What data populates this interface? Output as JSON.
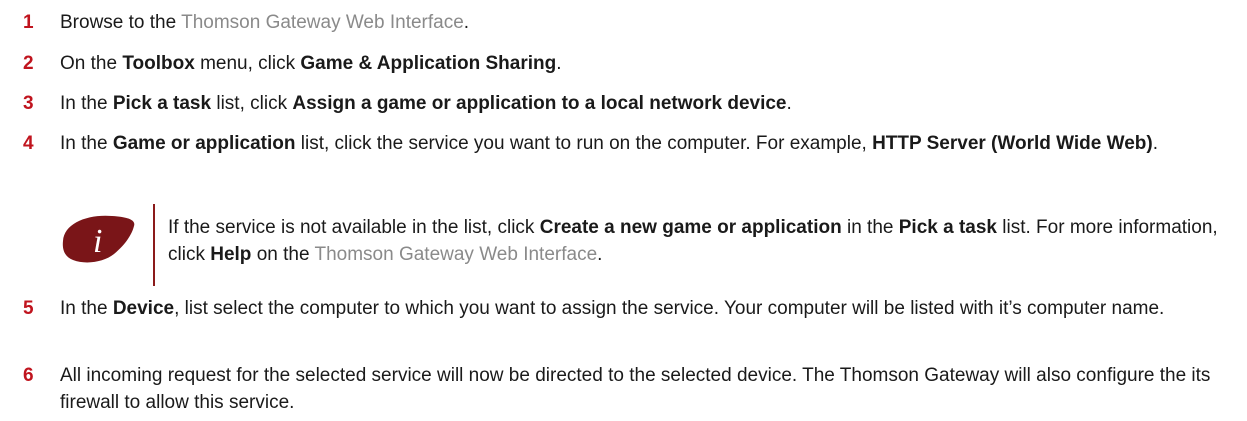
{
  "steps": [
    {
      "num": "1",
      "parts": [
        {
          "t": "Browse to the "
        },
        {
          "t": "Thomson Gateway Web Interface",
          "s": "link"
        },
        {
          "t": "."
        }
      ]
    },
    {
      "num": "2",
      "parts": [
        {
          "t": "On the "
        },
        {
          "t": "Toolbox",
          "s": "b"
        },
        {
          "t": " menu, click "
        },
        {
          "t": "Game & Application Sharing",
          "s": "b"
        },
        {
          "t": "."
        }
      ]
    },
    {
      "num": "3",
      "parts": [
        {
          "t": "In the "
        },
        {
          "t": "Pick a task",
          "s": "b"
        },
        {
          "t": " list, click "
        },
        {
          "t": "Assign a game or application to a local network device",
          "s": "b"
        },
        {
          "t": "."
        }
      ]
    },
    {
      "num": "4",
      "parts": [
        {
          "t": "In the "
        },
        {
          "t": "Game or application",
          "s": "b"
        },
        {
          "t": " list, click the service you want to run on the computer. For example, "
        },
        {
          "t": "HTTP Server (World Wide Web)",
          "s": "b"
        },
        {
          "t": "."
        }
      ]
    },
    {
      "num": "5",
      "parts": [
        {
          "t": "In the "
        },
        {
          "t": "Device",
          "s": "b"
        },
        {
          "t": ", list select the computer to which you want to assign the service. Your computer will be listed with it’s computer name."
        }
      ]
    },
    {
      "num": "6",
      "parts": [
        {
          "t": "All incoming request for the selected service will now be directed to the selected device. The Thomson Gateway will also configure the its firewall to allow this service."
        }
      ]
    }
  ],
  "note": {
    "icon": "info-icon",
    "icon_letter": "i",
    "parts": [
      {
        "t": "If the service is not available in the list, click "
      },
      {
        "t": "Create a new game or application",
        "s": "b"
      },
      {
        "t": " in the "
      },
      {
        "t": "Pick a task",
        "s": "b"
      },
      {
        "t": " list. For more information, click "
      },
      {
        "t": "Help",
        "s": "b"
      },
      {
        "t": " on the "
      },
      {
        "t": "Thomson Gateway Web Interface",
        "s": "link"
      },
      {
        "t": "."
      }
    ]
  },
  "colors": {
    "step_number": "#c0141e",
    "link_text": "#8a8a8a",
    "note_icon": "#7a1518",
    "note_bar": "#8b1a1a"
  }
}
